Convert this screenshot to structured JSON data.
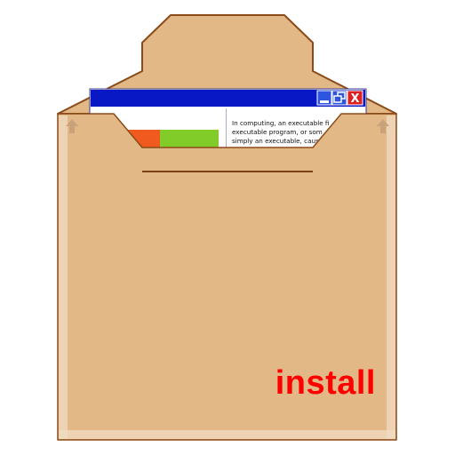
{
  "label": "install",
  "window": {
    "text_lines": [
      "In computing, an executable fi",
      "executable program, or som",
      "simply an executable, caus"
    ],
    "buttons": [
      "minimize",
      "maximize",
      "close"
    ],
    "close_glyph": "X"
  },
  "icons": {
    "left_arrow": "up-arrow-icon",
    "right_arrow": "up-arrow-icon"
  },
  "colors": {
    "box": "#e2b887",
    "box_outline": "#8a4b18",
    "box_edge": "#f0dcc2",
    "titlebar": "#0818c4",
    "close_button": "#e02020",
    "bar_orange": "#f05a1e",
    "bar_green": "#82cc2a",
    "label": "#ff0000"
  }
}
